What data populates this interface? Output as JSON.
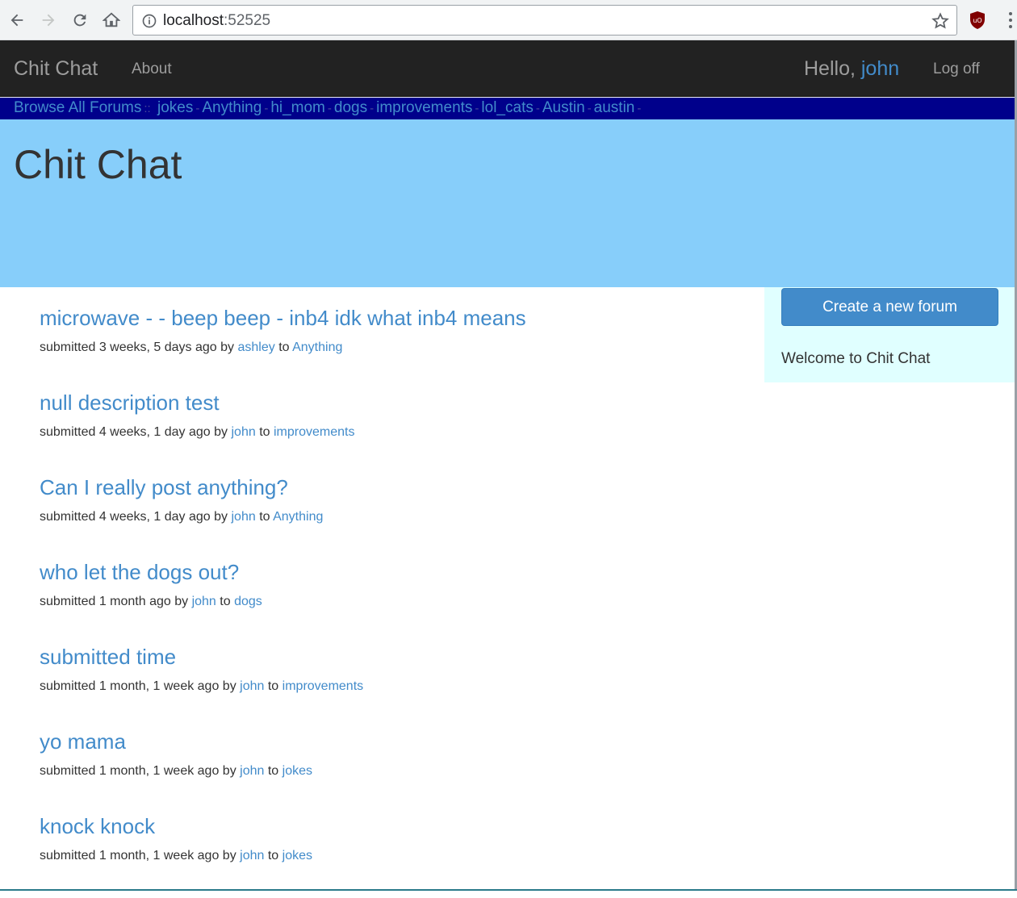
{
  "browser": {
    "url_host": "localhost",
    "url_port": ":52525"
  },
  "navbar": {
    "brand": "Chit Chat",
    "about": "About",
    "hello_prefix": "Hello, ",
    "username": "john",
    "logoff": "Log off"
  },
  "forumbar": {
    "browse_all": "Browse All Forums",
    "first_sep": "::",
    "sep": "-",
    "forums": [
      "jokes",
      "Anything",
      "hi_mom",
      "dogs",
      "improvements",
      "lol_cats",
      "Austin",
      "austin"
    ]
  },
  "jumbotron": {
    "title": "Chit Chat"
  },
  "posts": [
    {
      "title": "microwave - - beep beep - inb4 idk what inb4 means",
      "submitted": "submitted 3 weeks, 5 days ago by",
      "author": "ashley",
      "to": "to",
      "forum": "Anything"
    },
    {
      "title": "null description test",
      "submitted": "submitted 4 weeks, 1 day ago by",
      "author": "john",
      "to": "to",
      "forum": "improvements"
    },
    {
      "title": "Can I really post anything?",
      "submitted": "submitted 4 weeks, 1 day ago by",
      "author": "john",
      "to": "to",
      "forum": "Anything"
    },
    {
      "title": "who let the dogs out?",
      "submitted": "submitted 1 month ago by",
      "author": "john",
      "to": "to",
      "forum": "dogs"
    },
    {
      "title": "submitted time",
      "submitted": "submitted 1 month, 1 week ago by",
      "author": "john",
      "to": "to",
      "forum": "improvements"
    },
    {
      "title": "yo mama",
      "submitted": "submitted 1 month, 1 week ago by",
      "author": "john",
      "to": "to",
      "forum": "jokes"
    },
    {
      "title": "knock knock",
      "submitted": "submitted 1 month, 1 week ago by",
      "author": "john",
      "to": "to",
      "forum": "jokes"
    }
  ],
  "sidebar": {
    "create_button": "Create a new forum",
    "welcome": "Welcome to Chit Chat"
  }
}
